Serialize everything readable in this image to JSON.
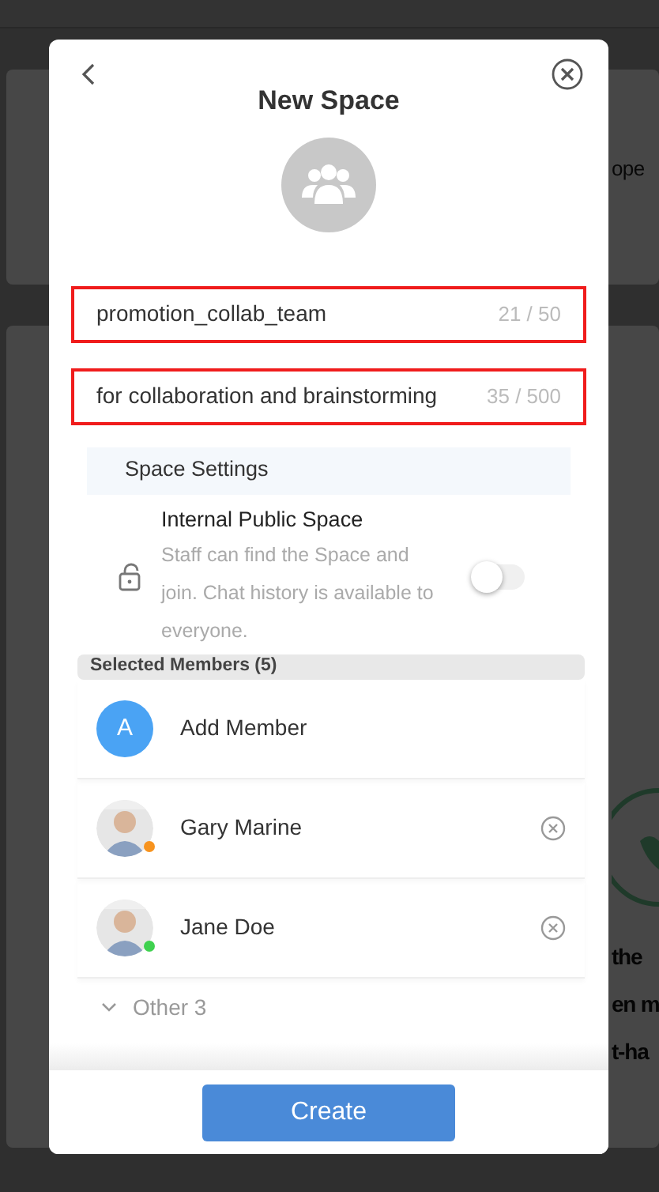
{
  "background": {
    "texts": [
      {
        "text": "ope",
        "kind": "small"
      },
      {
        "text": "the",
        "kind": "large"
      },
      {
        "text": "en m",
        "kind": "large"
      },
      {
        "text": "t-ha",
        "kind": "large"
      }
    ]
  },
  "dialog": {
    "title": "New Space",
    "fields": [
      {
        "value": "promotion_collab_team",
        "counter": "21 / 50",
        "highlighted": true
      },
      {
        "value": "for collaboration and brainstorming",
        "counter": "35 / 500",
        "highlighted": true
      }
    ],
    "settings": {
      "heading": "Space Settings",
      "option": {
        "title": "Internal Public Space",
        "description": "Staff can find the Space and join. Chat history is available to everyone.",
        "on": false
      }
    },
    "members_heading": "Selected Members (5)",
    "members": [
      {
        "kind": "add",
        "initial": "A",
        "name": "Add Member"
      },
      {
        "kind": "person",
        "name": "Gary Marine",
        "color": "#f7931e"
      },
      {
        "kind": "person",
        "name": "Jane Doe",
        "color": "#3fd14f"
      }
    ],
    "more": {
      "label": "Other 3",
      "expanded": false
    },
    "create_button": "Create"
  }
}
